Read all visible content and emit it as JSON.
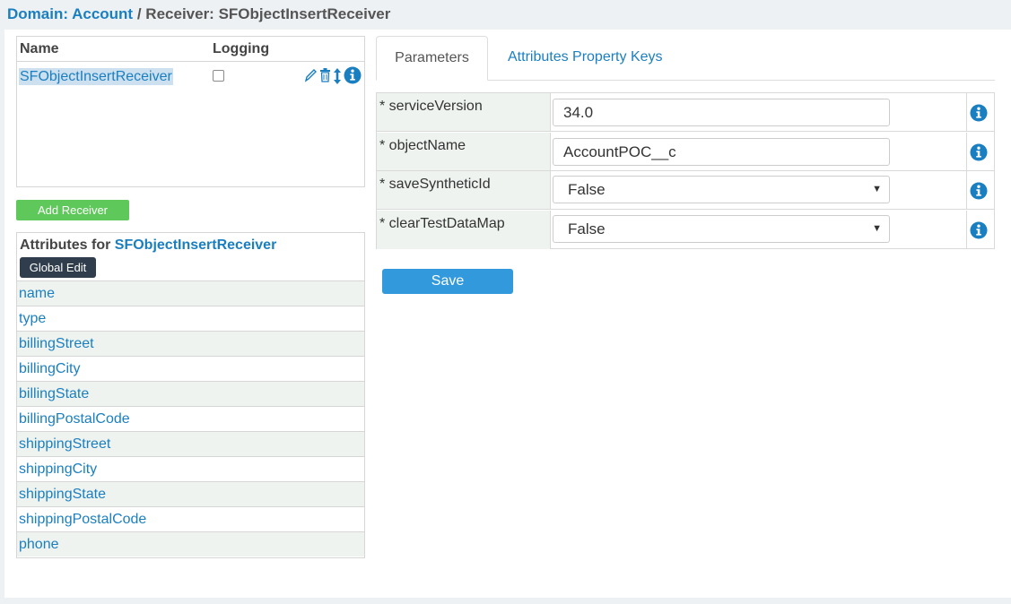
{
  "breadcrumb": {
    "domain_prefix": "Domain:",
    "domain_value": "Account",
    "separator": "/",
    "current": "Receiver: SFObjectInsertReceiver"
  },
  "receivers": {
    "headers": {
      "name": "Name",
      "logging": "Logging"
    },
    "rows": [
      {
        "name": "SFObjectInsertReceiver",
        "logging": false
      }
    ],
    "actions": [
      "edit-icon",
      "trash-icon",
      "reorder-icon",
      "info-icon"
    ]
  },
  "add_receiver_label": "Add Receiver",
  "attributes": {
    "title_prefix": "Attributes for",
    "receiver_name": "SFObjectInsertReceiver",
    "global_edit_label": "Global Edit",
    "items": [
      "name",
      "type",
      "billingStreet",
      "billingCity",
      "billingState",
      "billingPostalCode",
      "shippingStreet",
      "shippingCity",
      "shippingState",
      "shippingPostalCode",
      "phone"
    ]
  },
  "tabs": [
    {
      "label": "Parameters",
      "active": true
    },
    {
      "label": "Attributes Property Keys",
      "active": false
    }
  ],
  "params": [
    {
      "label": "* serviceVersion",
      "kind": "input",
      "value": "34.0"
    },
    {
      "label": "* objectName",
      "kind": "input",
      "value": "AccountPOC__c"
    },
    {
      "label": "* saveSyntheticId",
      "kind": "select",
      "value": "False"
    },
    {
      "label": "* clearTestDataMap",
      "kind": "select",
      "value": "False"
    }
  ],
  "save_label": "Save",
  "colors": {
    "link": "#1a7fc0",
    "add_button": "#5fc85a",
    "global_edit_button": "#2f3d4c",
    "save_button": "#3399dd",
    "row_shade": "#eef3ef"
  }
}
